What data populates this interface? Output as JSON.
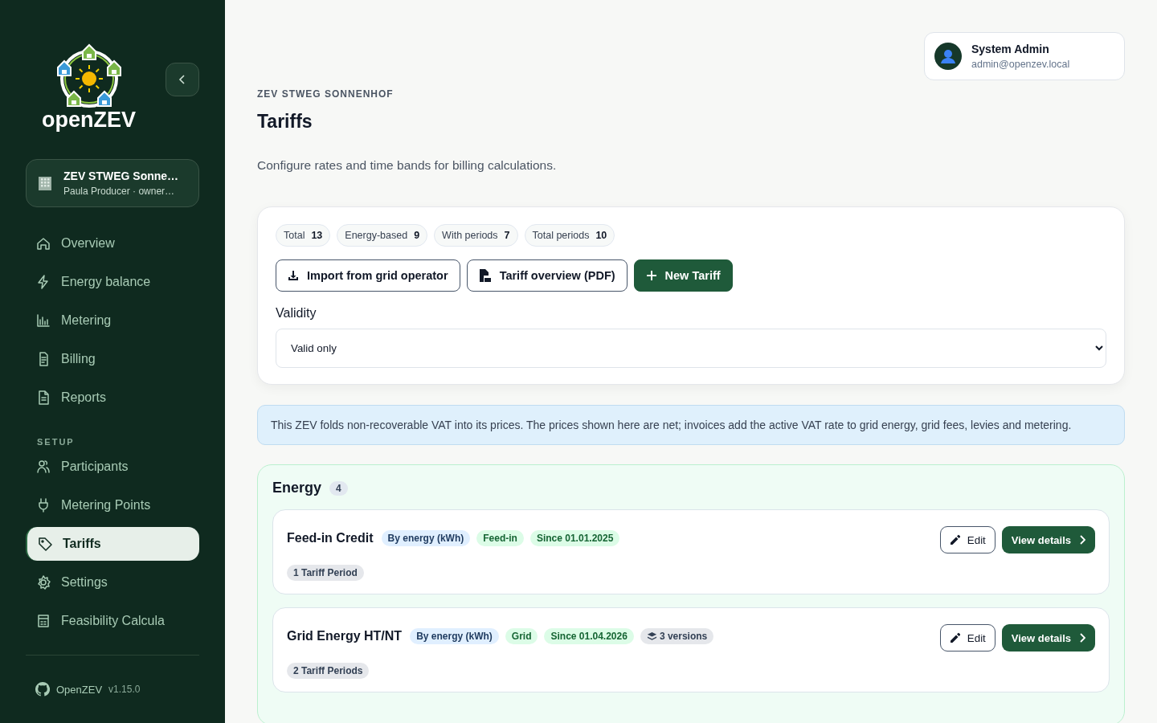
{
  "sidebar": {
    "brand": "openZEV",
    "community": {
      "name": "ZEV STWEG Sonne…",
      "subtitle": "Paula Producer · owner…"
    },
    "items": [
      {
        "label": "Overview",
        "selected": false
      },
      {
        "label": "Energy balance",
        "selected": false
      },
      {
        "label": "Metering",
        "selected": false
      },
      {
        "label": "Billing",
        "selected": false
      },
      {
        "label": "Reports",
        "selected": false
      }
    ],
    "setup_heading": "SETUP",
    "setup_items": [
      {
        "label": "Participants",
        "selected": false
      },
      {
        "label": "Metering Points",
        "selected": false
      },
      {
        "label": "Tariffs",
        "selected": true
      },
      {
        "label": "Settings",
        "selected": false
      },
      {
        "label": "Feasibility Calcula",
        "selected": false
      }
    ],
    "footer": {
      "name": "OpenZEV",
      "version": "v1.15.0"
    }
  },
  "user": {
    "name": "System Admin",
    "email": "admin@openzev.local"
  },
  "page": {
    "eyebrow": "ZEV STWEG SONNENHOF",
    "title": "Tariffs",
    "subtitle": "Configure rates and time bands for billing calculations."
  },
  "stats": [
    {
      "label": "Total",
      "value": "13"
    },
    {
      "label": "Energy-based",
      "value": "9"
    },
    {
      "label": "With periods",
      "value": "7"
    },
    {
      "label": "Total periods",
      "value": "10"
    }
  ],
  "actions": [
    {
      "kind": "import",
      "label": "Import from grid operator"
    },
    {
      "kind": "pdf",
      "label": "Tariff overview (PDF)"
    },
    {
      "kind": "new",
      "label": "New Tariff"
    }
  ],
  "validity": {
    "label": "Validity",
    "value": "Valid only"
  },
  "notice": "This ZEV folds non-recoverable VAT into its prices. The prices shown here are net; invoices add the active VAT rate to grid energy, grid fees, levies and metering.",
  "section": {
    "title": "Energy",
    "count": "4",
    "tariffs": [
      {
        "name": "Feed-in Credit",
        "tags": [
          {
            "kind": "unit",
            "text": "By energy (kWh)"
          },
          {
            "kind": "type",
            "text": "Feed-in"
          },
          {
            "kind": "since",
            "text": "Since 01.01.2025"
          }
        ],
        "periods": "1 Tariff Period",
        "edit": "Edit",
        "details": "View details"
      },
      {
        "name": "Grid Energy HT/NT",
        "tags": [
          {
            "kind": "unit",
            "text": "By energy (kWh)"
          },
          {
            "kind": "type",
            "text": "Grid"
          },
          {
            "kind": "since",
            "text": "Since 01.04.2026"
          },
          {
            "kind": "versions",
            "text": "3 versions"
          }
        ],
        "periods": "2 Tariff Periods",
        "edit": "Edit",
        "details": "View details"
      }
    ]
  }
}
